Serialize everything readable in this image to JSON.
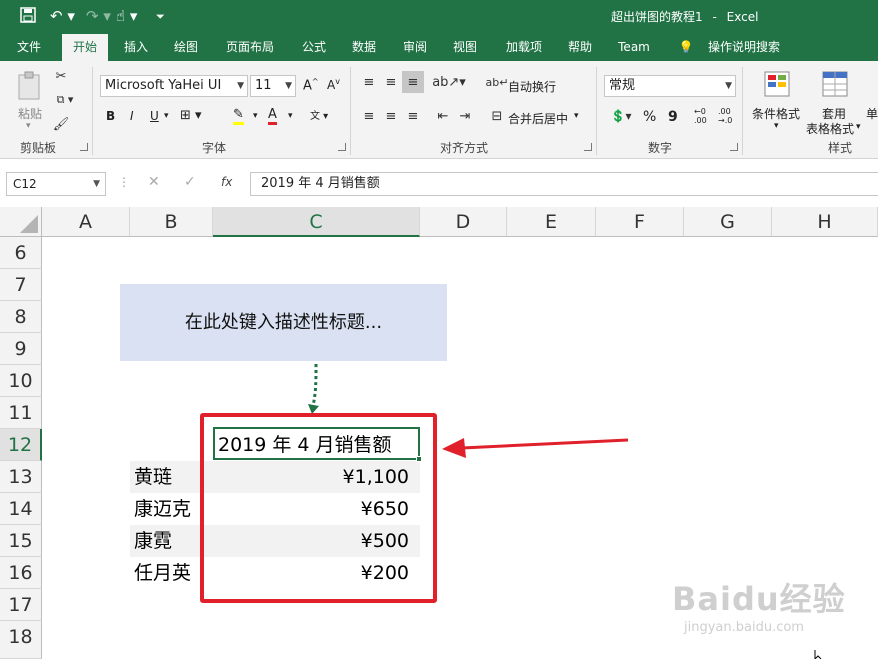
{
  "titlebar": {
    "doc_title": "超出饼图的教程1",
    "separator": "-",
    "app_name": "Excel"
  },
  "tabs": [
    "文件",
    "开始",
    "插入",
    "绘图",
    "页面布局",
    "公式",
    "数据",
    "审阅",
    "视图",
    "加载项",
    "帮助",
    "Team",
    "操作说明搜索"
  ],
  "active_tab": "开始",
  "ribbon": {
    "clipboard": {
      "paste_label": "粘贴",
      "group_label": "剪贴板"
    },
    "font": {
      "font_name": "Microsoft YaHei UI",
      "font_size": "11",
      "bold": "B",
      "italic": "I",
      "underline": "U",
      "group_label": "字体"
    },
    "alignment": {
      "wrap_text": "自动换行",
      "merge_center": "合并后居中",
      "group_label": "对齐方式"
    },
    "number": {
      "format": "常规",
      "percent": "%",
      "comma": "9",
      "group_label": "数字"
    },
    "styles": {
      "conditional": "条件格式",
      "table_format_top": "套用",
      "table_format_bottom": "表格格式",
      "cell_styles": "单",
      "group_label": "样式"
    }
  },
  "formula_bar": {
    "name_box": "C12",
    "fx": "fx",
    "content": "2019 年 4 月销售额"
  },
  "columns": [
    "A",
    "B",
    "C",
    "D",
    "E",
    "F",
    "G",
    "H"
  ],
  "selected_column": "C",
  "rows": [
    "6",
    "7",
    "8",
    "9",
    "10",
    "11",
    "12",
    "13",
    "14",
    "15",
    "16",
    "17",
    "18"
  ],
  "selected_row": "12",
  "title_placeholder": "在此处键入描述性标题...",
  "table": {
    "header": "2019 年 4 月销售额",
    "items": [
      {
        "name": "黄琏",
        "value": "¥1,100"
      },
      {
        "name": "康迈克",
        "value": "¥650"
      },
      {
        "name": "康霓",
        "value": "¥500"
      },
      {
        "name": "任月英",
        "value": "¥200"
      }
    ]
  },
  "watermark": {
    "brand": "Baidu经验",
    "url": "jingyan.baidu.com"
  },
  "colors": {
    "excel_green": "#217346",
    "annotation_red": "#e0202a",
    "title_fill": "#d9e1f2"
  }
}
